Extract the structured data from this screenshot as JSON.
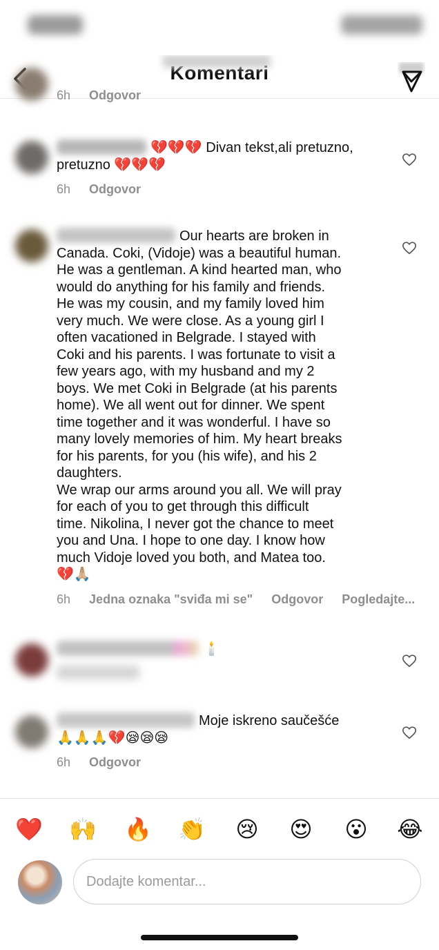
{
  "nav": {
    "title": "Komentari"
  },
  "comments": [
    {
      "text_after": "",
      "time": "6h",
      "reply": "Odgovor",
      "likes": "",
      "view": ""
    },
    {
      "text_lines": [
        "💔💔💔 Divan tekst,ali pretuzno,",
        "pretuzno 💔💔💔"
      ],
      "time": "6h",
      "reply": "Odgovor"
    },
    {
      "text_lines": [
        "Our hearts are broken in",
        "Canada. Coki, (Vidoje) was a beautiful human.",
        "He was a gentleman. A kind hearted man, who",
        "would do anything for his family and friends.",
        "He was my cousin, and my family loved him",
        "very much. We were close.  As a young girl I",
        "often vacationed in Belgrade. I stayed with",
        "Coki and his parents. I was fortunate to visit a",
        "few years ago, with my husband and my 2",
        "boys. We met Coki in Belgrade (at his parents",
        "home). We all went out for dinner. We spent",
        "time together and it was wonderful. I have so",
        "many lovely memories of him. My heart breaks",
        "for his parents, for you (his wife), and his 2",
        "daughters.",
        "We wrap our arms around you all. We will pray",
        "for each of you to get through this difficult",
        "time.  Nikolina, I never got the chance to meet",
        "you and Una. I hope to one day. I know how",
        "much Vidoje loved you both, and Matea too.",
        "💔🙏🏼"
      ],
      "time": "6h",
      "likes": "Jedna oznaka \"sviđa mi se\"",
      "reply": "Odgovor",
      "view": "Pogledajte..."
    },
    {
      "text_lines": [
        "🕯️"
      ],
      "time": "",
      "reply": ""
    },
    {
      "text_lines": [
        "Moje iskreno saučešće",
        "🙏🙏🙏💔😪😪😪"
      ],
      "time": "6h",
      "reply": "Odgovor"
    }
  ],
  "emoji_bar": [
    "❤️",
    "🙌",
    "🔥",
    "👏",
    "😢",
    "😍",
    "😮",
    "😂"
  ],
  "composer": {
    "placeholder": "Dodajte komentar..."
  },
  "colors": {
    "meta_gray": "#8e8e8e",
    "divider": "#e6e6e6"
  },
  "icons": {
    "back": "chevron-left-icon",
    "send": "send-icon",
    "like": "heart-outline-icon"
  }
}
